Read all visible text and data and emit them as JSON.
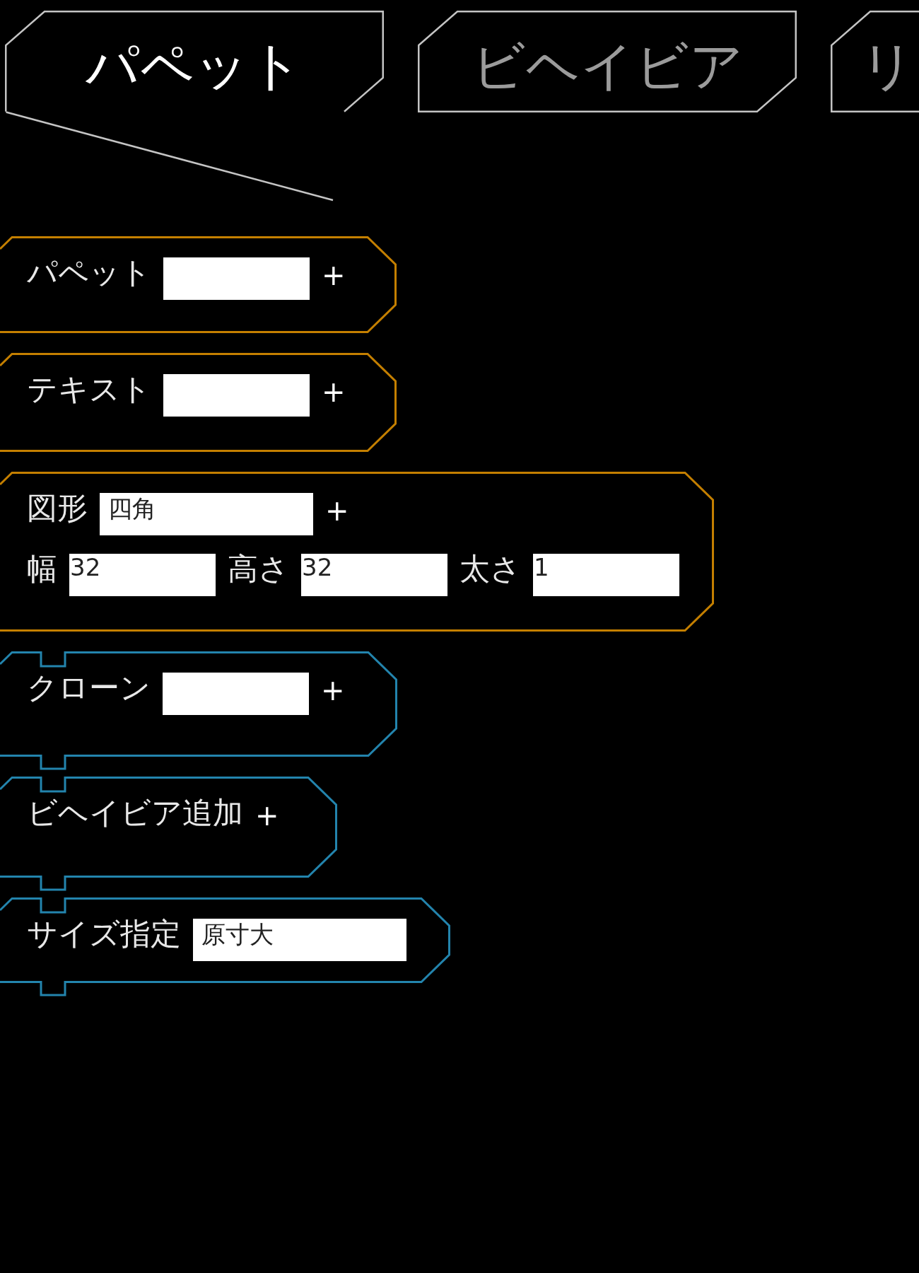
{
  "tabs": [
    {
      "label": "パペット",
      "selected": true
    },
    {
      "label": "ビヘイビア",
      "selected": false
    },
    {
      "label": "リ",
      "selected": false
    }
  ],
  "blocks": [
    {
      "kind": "plain",
      "color": "#c47f00",
      "rows": [
        [
          {
            "kind": "label",
            "text": "パペット"
          },
          {
            "kind": "input"
          },
          {
            "kind": "add",
            "text": "+"
          }
        ]
      ]
    },
    {
      "kind": "plain",
      "color": "#c47f00",
      "rows": [
        [
          {
            "kind": "label",
            "text": "テキスト"
          },
          {
            "kind": "input"
          },
          {
            "kind": "add",
            "text": "+"
          }
        ]
      ]
    },
    {
      "kind": "plain",
      "color": "#c47f00",
      "rows": [
        [
          {
            "kind": "label",
            "text": "図形"
          },
          {
            "kind": "select",
            "value": "四角"
          },
          {
            "kind": "add",
            "text": "+"
          }
        ],
        [
          {
            "kind": "label",
            "text": "幅"
          },
          {
            "kind": "input",
            "value": "32"
          },
          {
            "kind": "label",
            "text": "高さ"
          },
          {
            "kind": "input",
            "value": "32"
          },
          {
            "kind": "label",
            "text": "太さ"
          },
          {
            "kind": "input",
            "value": "1"
          }
        ]
      ]
    },
    {
      "kind": "stack",
      "color": "#2384ad",
      "rows": [
        [
          {
            "kind": "label",
            "text": "クローン"
          },
          {
            "kind": "input"
          },
          {
            "kind": "add",
            "text": "+"
          }
        ]
      ]
    },
    {
      "kind": "stack",
      "color": "#2384ad",
      "rows": [
        [
          {
            "kind": "label",
            "text": "ビヘイビア追加"
          },
          {
            "kind": "add",
            "text": "+"
          }
        ]
      ]
    },
    {
      "kind": "stack",
      "color": "#2384ad",
      "rows": [
        [
          {
            "kind": "label",
            "text": "サイズ指定"
          },
          {
            "kind": "select",
            "value": "原寸大"
          }
        ]
      ]
    }
  ]
}
